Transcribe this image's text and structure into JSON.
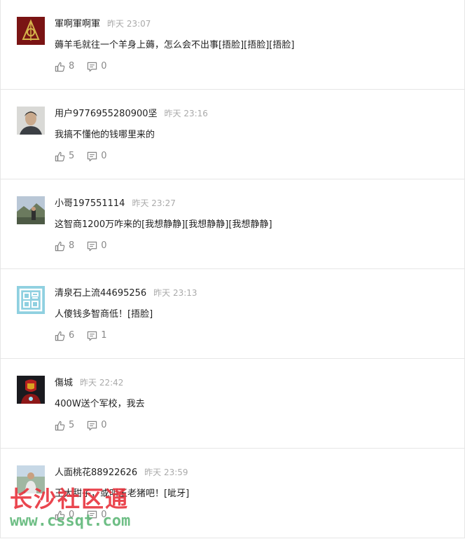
{
  "comments": [
    {
      "user": "軍啊軍啊軍",
      "time": "昨天 23:07",
      "text": "薅羊毛就往一个羊身上薅，怎么会不出事[捂脸][捂脸][捂脸]",
      "likes": "8",
      "replies": "0",
      "avatar": "emblem-avatar"
    },
    {
      "user": "用户9776955280900坚",
      "time": "昨天 23:16",
      "text": "我搞不懂他的钱哪里来的",
      "likes": "5",
      "replies": "0",
      "avatar": "man-portrait-avatar"
    },
    {
      "user": "小哥197551114",
      "time": "昨天 23:27",
      "text": "这智商1200万咋来的[我想静静][我想静静][我想静静]",
      "likes": "8",
      "replies": "0",
      "avatar": "landscape-avatar"
    },
    {
      "user": "清泉石上流44695256",
      "time": "昨天 23:13",
      "text": "人傻钱多智商低！[捂脸]",
      "likes": "6",
      "replies": "1",
      "avatar": "seal-avatar"
    },
    {
      "user": "傷城",
      "time": "昨天 22:42",
      "text": "400W送个军校，我去",
      "likes": "5",
      "replies": "0",
      "avatar": "iron-man-avatar"
    },
    {
      "user": "人面桃花88922626",
      "time": "昨天 23:59",
      "text": "王大甜子，或叫王老猪吧！[呲牙]",
      "likes": "0",
      "replies": "0",
      "avatar": "outdoor-person-avatar"
    }
  ],
  "watermark": {
    "title": "长沙社区通",
    "url": "www.cssqt.com"
  },
  "colors": {
    "border": "#e6e6e6",
    "meta": "#aaaaaa",
    "action": "#888888",
    "watermark_red": "#e8323c",
    "watermark_green": "#5fb878"
  }
}
